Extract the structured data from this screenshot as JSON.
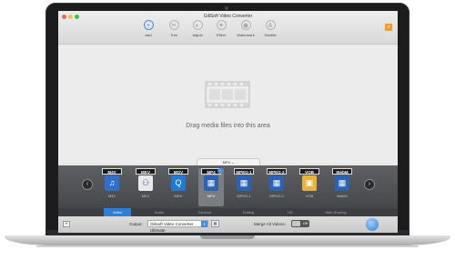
{
  "window": {
    "title": "GiliSoft Video Converter"
  },
  "toolbar": {
    "items": [
      {
        "label": "Add",
        "icon": "plus-circle-icon"
      },
      {
        "label": "Trim",
        "icon": "scissors-icon"
      },
      {
        "label": "Adjust",
        "icon": "adjust-icon"
      },
      {
        "label": "Effect",
        "icon": "effect-icon"
      },
      {
        "label": "Watermark",
        "icon": "watermark-icon"
      },
      {
        "label": "Subtitle",
        "icon": "subtitle-icon"
      }
    ]
  },
  "drop_area": {
    "text": "Drag media files into this area"
  },
  "format_selector": {
    "current": "MP4",
    "formats": [
      {
        "badge": "M4V",
        "name": "M4V"
      },
      {
        "badge": "MKV",
        "name": "MKV"
      },
      {
        "badge": "MOV",
        "name": "MOV"
      },
      {
        "badge": "MP4",
        "name": "MP4",
        "selected": true
      },
      {
        "badge": "MPEG-1",
        "name": "MPEG-1"
      },
      {
        "badge": "MPEG-2",
        "name": "MPEG-2"
      },
      {
        "badge": "VOB",
        "name": "VOB"
      },
      {
        "badge": "WebM",
        "name": "WebM"
      }
    ]
  },
  "categories": [
    {
      "label": "Video",
      "active": true
    },
    {
      "label": "Audio"
    },
    {
      "label": "Devices"
    },
    {
      "label": "Editing"
    },
    {
      "label": "HD"
    },
    {
      "label": "Web Sharing"
    }
  ],
  "bottom_bar": {
    "add_label": "+",
    "output_label": "Output:",
    "output_value": "Gilisoft Video Converter Ultimate",
    "merge_label": "Merge All Videos:",
    "merge_state": "Off"
  },
  "colors": {
    "accent": "#2f7fd9",
    "format_bar": "#4f5054",
    "register": "#f59a23"
  }
}
